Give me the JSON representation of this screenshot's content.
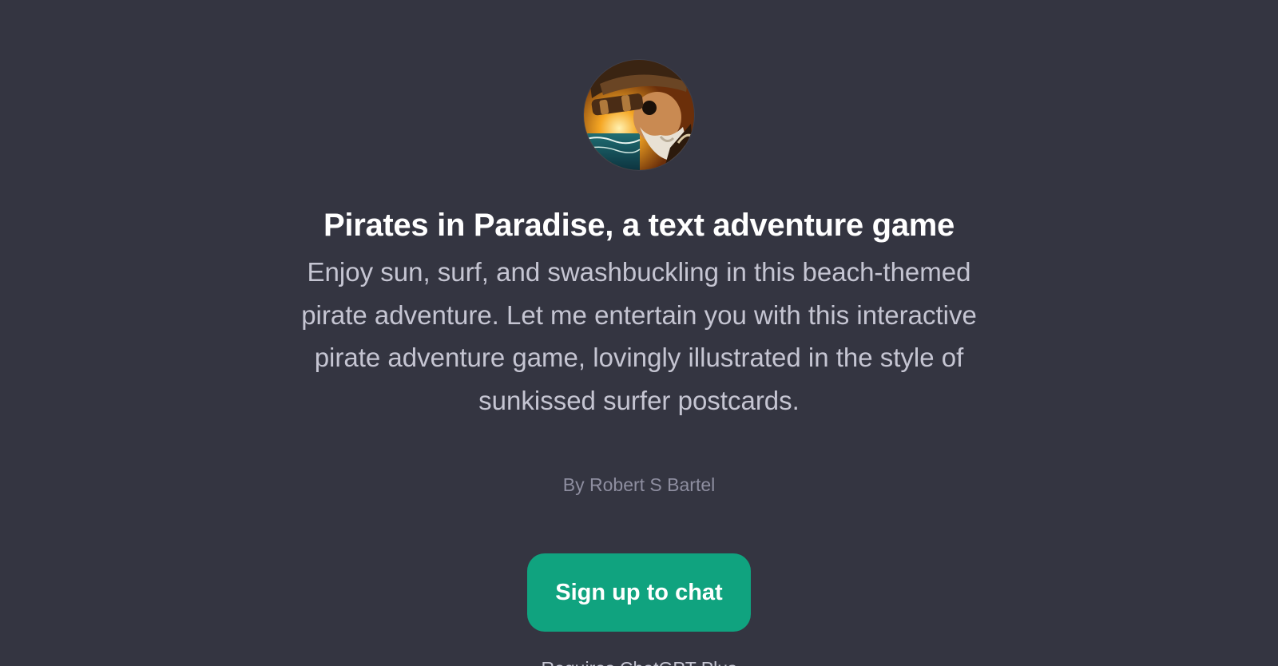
{
  "gpt": {
    "avatar_icon": "pirate-spyglass-avatar",
    "title": "Pirates in Paradise, a text adventure game",
    "description": "Enjoy sun, surf, and swashbuckling in this beach-themed pirate adventure. Let me entertain you with this interactive pirate adventure game, lovingly illustrated in the style of sunkissed surfer postcards.",
    "author": "By Robert S Bartel"
  },
  "actions": {
    "signup_label": "Sign up to chat"
  },
  "footer": {
    "text": "Requires ChatGPT Plus"
  },
  "colors": {
    "background": "#343541",
    "accent": "#10a37f",
    "title": "#ffffff",
    "description": "#c5c5d2",
    "author": "#8e8ea0"
  }
}
